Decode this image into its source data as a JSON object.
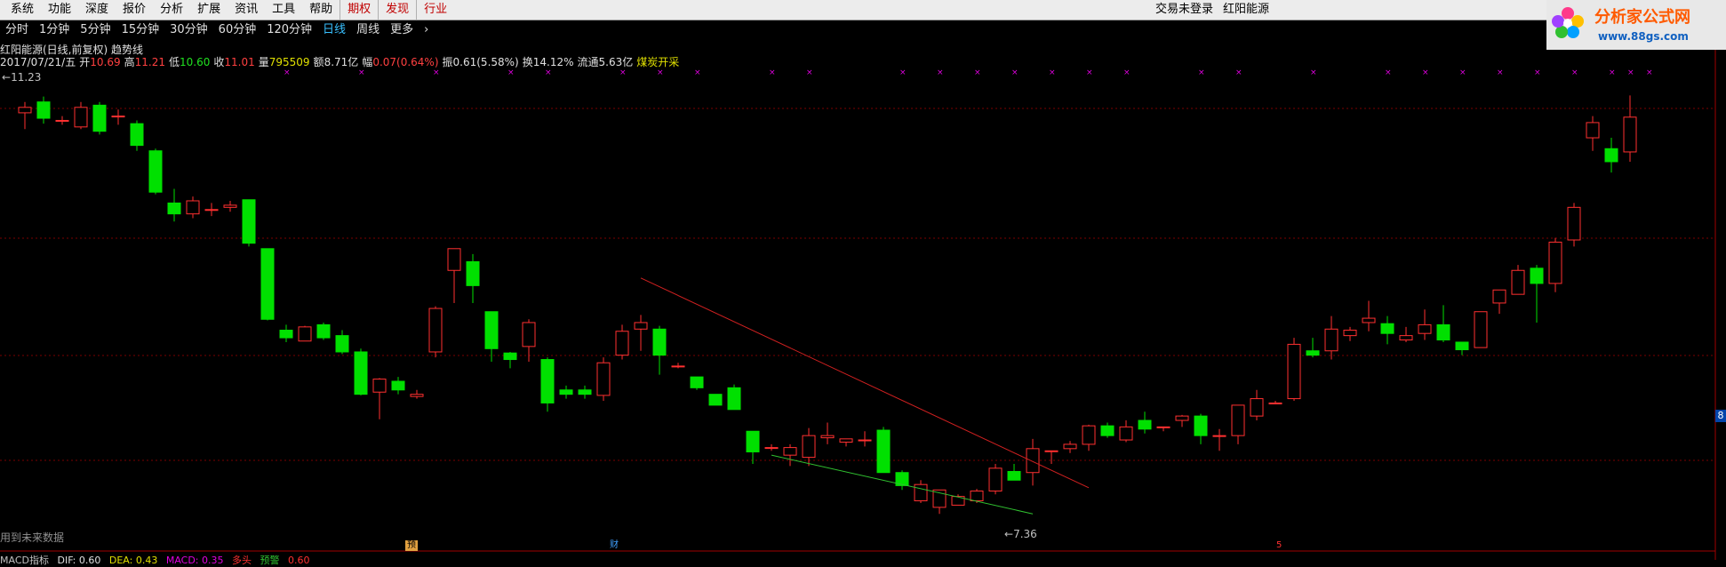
{
  "menubar": {
    "items": [
      "系统",
      "功能",
      "深度",
      "报价",
      "分析",
      "扩展",
      "资讯",
      "工具",
      "帮助"
    ],
    "highlight_items": [
      "期权",
      "发现",
      "行业"
    ],
    "login_status": "交易未登录",
    "stock_name": "红阳能源"
  },
  "logo": {
    "text": "分析家公式网",
    "url_text": "www.88gs.com"
  },
  "periods": {
    "items": [
      "分时",
      "1分钟",
      "5分钟",
      "15分钟",
      "30分钟",
      "60分钟",
      "120分钟",
      "日线",
      "周线",
      "更多"
    ],
    "active": "日线",
    "more_arrow": "›"
  },
  "info_line1": "红阳能源(日线,前复权) 趋势线",
  "info_line2": {
    "date": "2017/07/21/五",
    "open_label": "开",
    "open": "10.69",
    "high_label": "高",
    "high": "11.21",
    "low_label": "低",
    "low": "10.60",
    "close_label": "收",
    "close": "11.01",
    "vol_label": "量",
    "vol": "795509",
    "amount_label": "额",
    "amount": "8.71亿",
    "chg_label": "幅",
    "chg": "0.07(0.64%)",
    "amp_label": "振",
    "amp": "0.61(5.58%)",
    "turn_label": "换",
    "turn": "14.12%",
    "float_label": "流通",
    "float": "5.63亿",
    "sector": "煤炭开采"
  },
  "max_label": "11.23",
  "min_label": "7.36",
  "future_note": "用到未来数据",
  "event_tags": {
    "tag1": "预",
    "tag2": "财",
    "tag3": "5"
  },
  "right_axis_value": "8",
  "macd": {
    "name": "MACD指标",
    "dif": "DIF: 0.60",
    "dea": "DEA: 0.43",
    "macd": "MACD: 0.35",
    "extra1": "多头",
    "extra2": "预警",
    "extra3": "0.60"
  },
  "colors": {
    "up": "#ff3030",
    "down": "#00e000",
    "trend_down": "#d02020",
    "trend_low": "#30c030",
    "grid": "#7a0000",
    "marker": "#e000e0"
  },
  "chart_data": {
    "type": "candlestick",
    "price_range": [
      7.0,
      11.5
    ],
    "candles": [
      {
        "o": 11.05,
        "h": 11.15,
        "l": 10.9,
        "c": 11.1
      },
      {
        "o": 11.15,
        "h": 11.2,
        "l": 10.95,
        "c": 11.0
      },
      {
        "o": 10.98,
        "h": 11.02,
        "l": 10.94,
        "c": 10.98
      },
      {
        "o": 10.92,
        "h": 11.15,
        "l": 10.9,
        "c": 11.1
      },
      {
        "o": 11.12,
        "h": 11.15,
        "l": 10.85,
        "c": 10.88
      },
      {
        "o": 11.02,
        "h": 11.08,
        "l": 10.94,
        "c": 11.02
      },
      {
        "o": 10.95,
        "h": 10.98,
        "l": 10.7,
        "c": 10.75
      },
      {
        "o": 10.7,
        "h": 10.72,
        "l": 10.3,
        "c": 10.32
      },
      {
        "o": 10.22,
        "h": 10.35,
        "l": 10.05,
        "c": 10.12
      },
      {
        "o": 10.12,
        "h": 10.28,
        "l": 10.08,
        "c": 10.24
      },
      {
        "o": 10.16,
        "h": 10.22,
        "l": 10.1,
        "c": 10.16
      },
      {
        "o": 10.18,
        "h": 10.24,
        "l": 10.14,
        "c": 10.2
      },
      {
        "o": 10.25,
        "h": 10.25,
        "l": 9.82,
        "c": 9.85
      },
      {
        "o": 9.8,
        "h": 9.8,
        "l": 9.14,
        "c": 9.15
      },
      {
        "o": 9.05,
        "h": 9.1,
        "l": 8.94,
        "c": 8.98
      },
      {
        "o": 8.95,
        "h": 9.09,
        "l": 8.95,
        "c": 9.08
      },
      {
        "o": 9.1,
        "h": 9.12,
        "l": 8.96,
        "c": 8.98
      },
      {
        "o": 9.0,
        "h": 9.05,
        "l": 8.83,
        "c": 8.85
      },
      {
        "o": 8.85,
        "h": 8.88,
        "l": 8.45,
        "c": 8.46
      },
      {
        "o": 8.48,
        "h": 8.61,
        "l": 8.23,
        "c": 8.6
      },
      {
        "o": 8.58,
        "h": 8.62,
        "l": 8.46,
        "c": 8.5
      },
      {
        "o": 8.44,
        "h": 8.5,
        "l": 8.42,
        "c": 8.46
      },
      {
        "o": 8.85,
        "h": 9.27,
        "l": 8.8,
        "c": 9.25
      },
      {
        "o": 9.6,
        "h": 9.75,
        "l": 9.3,
        "c": 9.8
      },
      {
        "o": 9.68,
        "h": 9.75,
        "l": 9.3,
        "c": 9.46
      },
      {
        "o": 9.22,
        "h": 9.22,
        "l": 8.76,
        "c": 8.88
      },
      {
        "o": 8.84,
        "h": 8.85,
        "l": 8.7,
        "c": 8.78
      },
      {
        "o": 8.9,
        "h": 9.15,
        "l": 8.76,
        "c": 9.12
      },
      {
        "o": 8.78,
        "h": 8.8,
        "l": 8.3,
        "c": 8.38
      },
      {
        "o": 8.5,
        "h": 8.54,
        "l": 8.42,
        "c": 8.46
      },
      {
        "o": 8.5,
        "h": 8.54,
        "l": 8.42,
        "c": 8.46
      },
      {
        "o": 8.45,
        "h": 8.8,
        "l": 8.4,
        "c": 8.75
      },
      {
        "o": 8.82,
        "h": 9.1,
        "l": 8.78,
        "c": 9.04
      },
      {
        "o": 9.06,
        "h": 9.19,
        "l": 8.86,
        "c": 9.12
      },
      {
        "o": 9.06,
        "h": 9.09,
        "l": 8.64,
        "c": 8.82
      },
      {
        "o": 8.72,
        "h": 8.75,
        "l": 8.7,
        "c": 8.72
      },
      {
        "o": 8.62,
        "h": 8.62,
        "l": 8.5,
        "c": 8.52
      },
      {
        "o": 8.46,
        "h": 8.46,
        "l": 8.36,
        "c": 8.36
      },
      {
        "o": 8.52,
        "h": 8.55,
        "l": 8.32,
        "c": 8.32
      },
      {
        "o": 8.12,
        "h": 8.12,
        "l": 7.82,
        "c": 7.93
      },
      {
        "o": 7.97,
        "h": 8.0,
        "l": 7.94,
        "c": 7.97
      },
      {
        "o": 7.9,
        "h": 8.0,
        "l": 7.8,
        "c": 7.97
      },
      {
        "o": 7.88,
        "h": 8.15,
        "l": 7.8,
        "c": 8.08
      },
      {
        "o": 8.06,
        "h": 8.2,
        "l": 8.0,
        "c": 8.08
      },
      {
        "o": 8.02,
        "h": 8.05,
        "l": 7.98,
        "c": 8.05
      },
      {
        "o": 8.04,
        "h": 8.12,
        "l": 7.98,
        "c": 8.04
      },
      {
        "o": 8.13,
        "h": 8.16,
        "l": 7.74,
        "c": 7.74
      },
      {
        "o": 7.74,
        "h": 7.76,
        "l": 7.58,
        "c": 7.62
      },
      {
        "o": 7.48,
        "h": 7.67,
        "l": 7.46,
        "c": 7.63
      },
      {
        "o": 7.42,
        "h": 7.58,
        "l": 7.36,
        "c": 7.58
      },
      {
        "o": 7.44,
        "h": 7.54,
        "l": 7.44,
        "c": 7.52
      },
      {
        "o": 7.48,
        "h": 7.59,
        "l": 7.46,
        "c": 7.57
      },
      {
        "o": 7.57,
        "h": 7.82,
        "l": 7.54,
        "c": 7.78
      },
      {
        "o": 7.75,
        "h": 7.82,
        "l": 7.75,
        "c": 7.67
      },
      {
        "o": 7.74,
        "h": 8.05,
        "l": 7.62,
        "c": 7.96
      },
      {
        "o": 7.94,
        "h": 7.94,
        "l": 7.82,
        "c": 7.94
      },
      {
        "o": 7.96,
        "h": 8.03,
        "l": 7.92,
        "c": 8.0
      },
      {
        "o": 8.0,
        "h": 8.18,
        "l": 7.94,
        "c": 8.17
      },
      {
        "o": 8.17,
        "h": 8.2,
        "l": 8.06,
        "c": 8.08
      },
      {
        "o": 8.04,
        "h": 8.22,
        "l": 8.02,
        "c": 8.16
      },
      {
        "o": 8.22,
        "h": 8.3,
        "l": 8.1,
        "c": 8.14
      },
      {
        "o": 8.16,
        "h": 8.16,
        "l": 8.12,
        "c": 8.16
      },
      {
        "o": 8.22,
        "h": 8.27,
        "l": 8.16,
        "c": 8.26
      },
      {
        "o": 8.26,
        "h": 8.28,
        "l": 8.0,
        "c": 8.08
      },
      {
        "o": 8.08,
        "h": 8.14,
        "l": 7.94,
        "c": 8.08
      },
      {
        "o": 8.08,
        "h": 8.15,
        "l": 8.0,
        "c": 8.36
      },
      {
        "o": 8.26,
        "h": 8.5,
        "l": 8.22,
        "c": 8.42
      },
      {
        "o": 8.38,
        "h": 8.4,
        "l": 8.38,
        "c": 8.38
      },
      {
        "o": 8.42,
        "h": 8.98,
        "l": 8.4,
        "c": 8.92
      },
      {
        "o": 8.86,
        "h": 8.98,
        "l": 8.8,
        "c": 8.82
      },
      {
        "o": 8.86,
        "h": 9.18,
        "l": 8.78,
        "c": 9.06
      },
      {
        "o": 9.0,
        "h": 9.08,
        "l": 8.95,
        "c": 9.05
      },
      {
        "o": 9.12,
        "h": 9.32,
        "l": 9.04,
        "c": 9.16
      },
      {
        "o": 9.11,
        "h": 9.18,
        "l": 8.92,
        "c": 9.02
      },
      {
        "o": 8.96,
        "h": 9.08,
        "l": 8.94,
        "c": 9.0
      },
      {
        "o": 9.02,
        "h": 9.24,
        "l": 8.96,
        "c": 9.1
      },
      {
        "o": 9.1,
        "h": 9.28,
        "l": 8.94,
        "c": 8.96
      },
      {
        "o": 8.94,
        "h": 8.94,
        "l": 8.82,
        "c": 8.87
      },
      {
        "o": 8.89,
        "h": 8.9,
        "l": 8.89,
        "c": 9.22
      },
      {
        "o": 9.3,
        "h": 9.42,
        "l": 9.2,
        "c": 9.42
      },
      {
        "o": 9.38,
        "h": 9.65,
        "l": 9.4,
        "c": 9.6
      },
      {
        "o": 9.62,
        "h": 9.65,
        "l": 9.12,
        "c": 9.48
      },
      {
        "o": 9.48,
        "h": 9.9,
        "l": 9.4,
        "c": 9.86
      },
      {
        "o": 9.88,
        "h": 10.22,
        "l": 9.82,
        "c": 10.18
      },
      {
        "o": 10.82,
        "h": 11.02,
        "l": 10.7,
        "c": 10.96
      },
      {
        "o": 10.72,
        "h": 10.82,
        "l": 10.5,
        "c": 10.6
      },
      {
        "o": 10.69,
        "h": 11.21,
        "l": 10.6,
        "c": 11.01
      }
    ],
    "trend_lines": [
      {
        "kind": "resistance",
        "from": [
          33,
          9.53
        ],
        "to": [
          57,
          7.6
        ]
      },
      {
        "kind": "support",
        "from": [
          40,
          7.9
        ],
        "to": [
          54,
          7.36
        ]
      }
    ]
  }
}
